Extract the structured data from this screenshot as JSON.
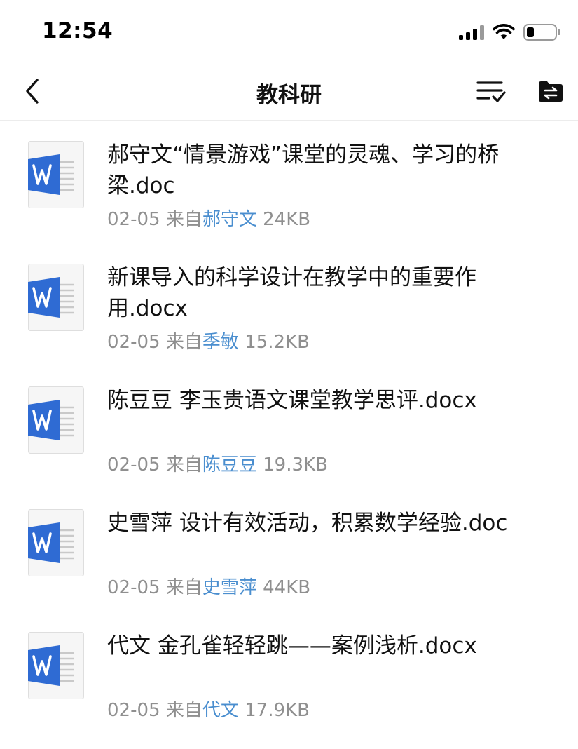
{
  "status_bar": {
    "time": "12:54"
  },
  "nav": {
    "title": "教科研",
    "icons": {
      "back": "chevron-left-icon",
      "sort": "sort-check-icon",
      "folder": "folder-transfer-icon"
    }
  },
  "files": [
    {
      "name": "郝守文“情景游戏”课堂的灵魂、学习的桥梁.doc",
      "date": "02-05",
      "from_label": "来自",
      "sender": "郝守文",
      "size": "24KB",
      "icon": "word-doc-icon"
    },
    {
      "name": "新课导入的科学设计在教学中的重要作用.docx",
      "date": "02-05",
      "from_label": "来自",
      "sender": "季敏",
      "size": "15.2KB",
      "icon": "word-doc-icon"
    },
    {
      "name": "陈豆豆 李玉贵语文课堂教学思评.docx",
      "date": "02-05",
      "from_label": "来自",
      "sender": "陈豆豆",
      "size": "19.3KB",
      "icon": "word-doc-icon"
    },
    {
      "name": "史雪萍 设计有效活动，积累数学经验.doc",
      "date": "02-05",
      "from_label": "来自",
      "sender": "史雪萍",
      "size": "44KB",
      "icon": "word-doc-icon"
    },
    {
      "name": "代文 金孔雀轻轻跳——案例浅析.docx",
      "date": "02-05",
      "from_label": "来自",
      "sender": "代文",
      "size": "17.9KB",
      "icon": "word-doc-icon"
    }
  ],
  "colors": {
    "word_blue": "#2f6bd3",
    "sender_link": "#4a8ecf",
    "meta_gray": "#8f8f8f"
  }
}
